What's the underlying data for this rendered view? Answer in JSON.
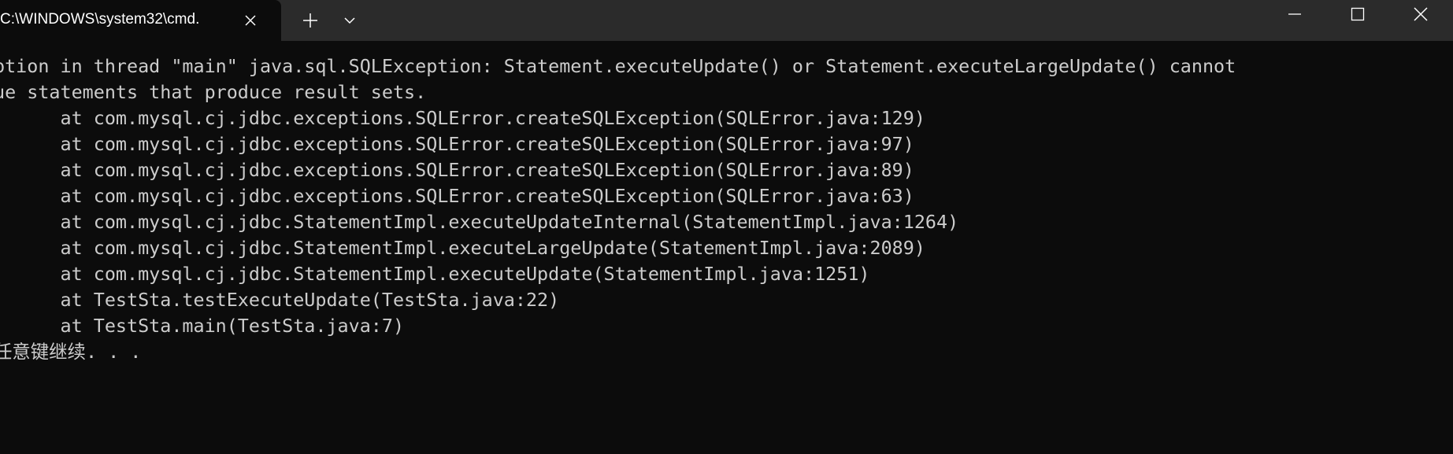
{
  "window": {
    "tab_title": "C:\\WINDOWS\\system32\\cmd.",
    "icons": {
      "tab_close": "close-icon",
      "new_tab": "plus-icon",
      "dropdown": "chevron-down-icon",
      "minimize": "minimize-icon",
      "maximize": "maximize-icon",
      "close": "close-icon"
    }
  },
  "console": {
    "lines": [
      "ption in thread \"main\" java.sql.SQLException: Statement.executeUpdate() or Statement.executeLargeUpdate() cannot",
      "ue statements that produce result sets.",
      "      at com.mysql.cj.jdbc.exceptions.SQLError.createSQLException(SQLError.java:129)",
      "      at com.mysql.cj.jdbc.exceptions.SQLError.createSQLException(SQLError.java:97)",
      "      at com.mysql.cj.jdbc.exceptions.SQLError.createSQLException(SQLError.java:89)",
      "      at com.mysql.cj.jdbc.exceptions.SQLError.createSQLException(SQLError.java:63)",
      "      at com.mysql.cj.jdbc.StatementImpl.executeUpdateInternal(StatementImpl.java:1264)",
      "      at com.mysql.cj.jdbc.StatementImpl.executeLargeUpdate(StatementImpl.java:2089)",
      "      at com.mysql.cj.jdbc.StatementImpl.executeUpdate(StatementImpl.java:1251)",
      "      at TestSta.testExecuteUpdate(TestSta.java:22)",
      "      at TestSta.main(TestSta.java:7)",
      "任意键继续. . ."
    ]
  },
  "colors": {
    "background": "#0c0c0c",
    "titlebar": "#2b2b2b",
    "text": "#cccccc"
  }
}
